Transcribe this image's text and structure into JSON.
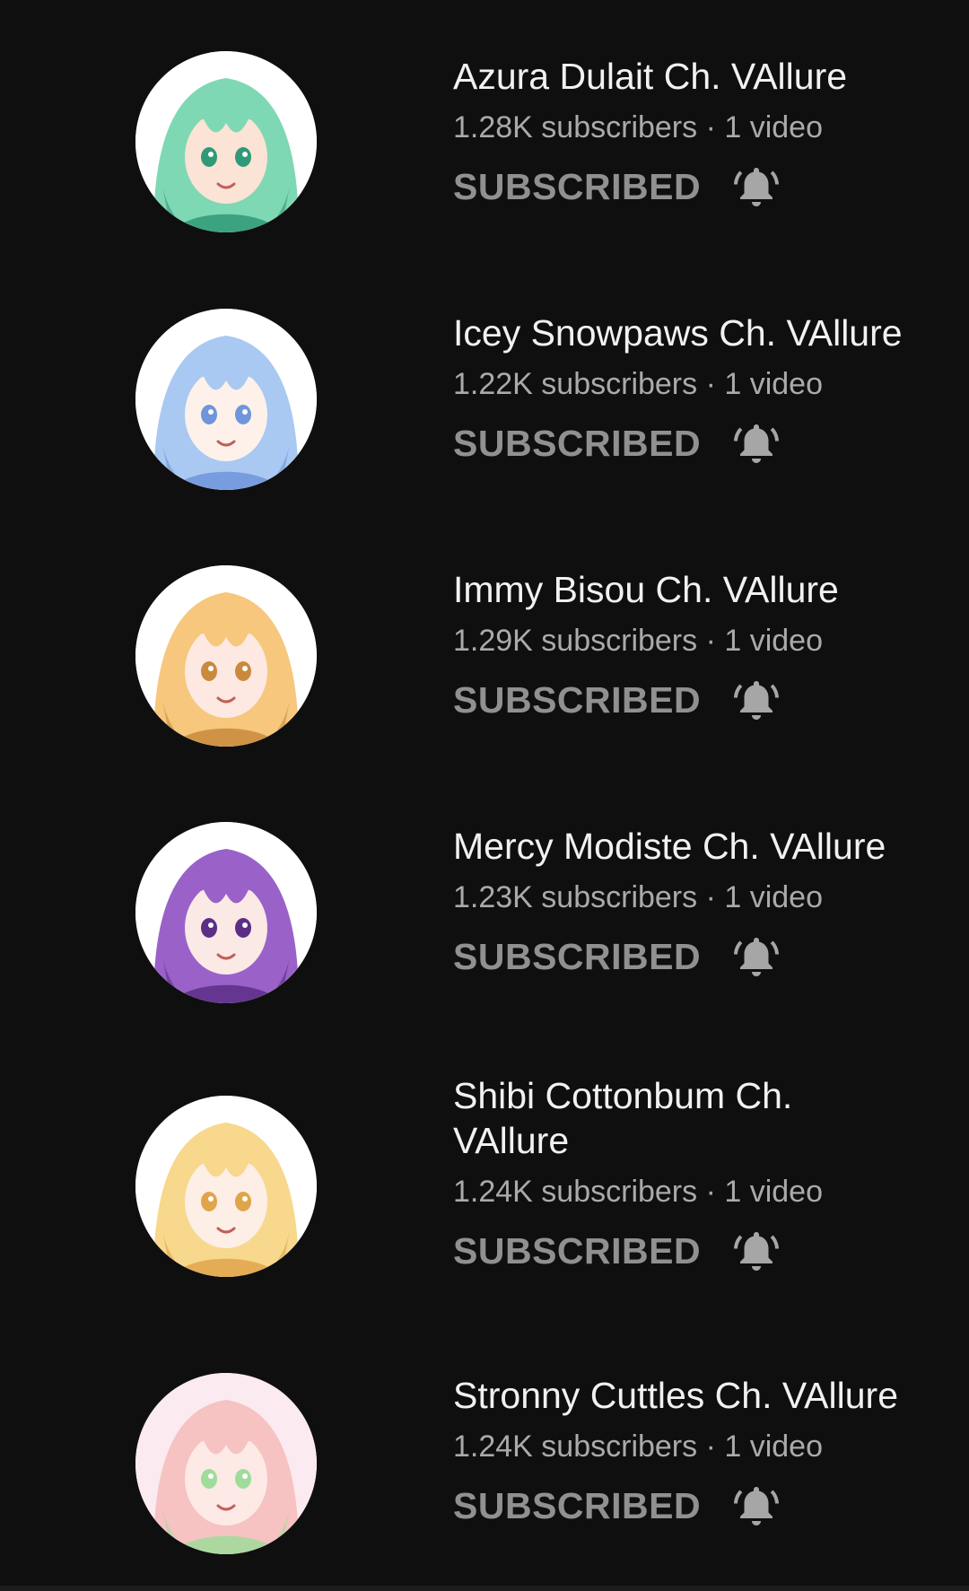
{
  "channels": [
    {
      "name": "Azura Dulait Ch. VAllure",
      "meta": "1.28K subscribers · 1 video",
      "button_label": "SUBSCRIBED",
      "bell_icon": "bell-ringing-icon",
      "avatar_colors": {
        "hair": "#7fd8b4",
        "accent": "#2f9a77",
        "skin": "#fbe3d6",
        "bg": "#ffffff"
      }
    },
    {
      "name": "Icey Snowpaws Ch. VAllure",
      "meta": "1.22K subscribers · 1 video",
      "button_label": "SUBSCRIBED",
      "bell_icon": "bell-ringing-icon",
      "avatar_colors": {
        "hair": "#a9c9f2",
        "accent": "#6f95db",
        "skin": "#fdf1ea",
        "bg": "#ffffff"
      }
    },
    {
      "name": "Immy Bisou Ch. VAllure",
      "meta": "1.29K subscribers · 1 video",
      "button_label": "SUBSCRIBED",
      "bell_icon": "bell-ringing-icon",
      "avatar_colors": {
        "hair": "#f6c77c",
        "accent": "#c98a3d",
        "skin": "#fde9e2",
        "bg": "#ffffff"
      }
    },
    {
      "name": "Mercy Modiste Ch. VAllure",
      "meta": "1.23K subscribers · 1 video",
      "button_label": "SUBSCRIBED",
      "bell_icon": "bell-ringing-icon",
      "avatar_colors": {
        "hair": "#9a62c9",
        "accent": "#5b2f86",
        "skin": "#fbe9e6",
        "bg": "#ffffff"
      }
    },
    {
      "name": "Shibi Cottonbum Ch. VAllure",
      "meta": "1.24K subscribers · 1 video",
      "button_label": "SUBSCRIBED",
      "bell_icon": "bell-ringing-icon",
      "avatar_colors": {
        "hair": "#f7d88c",
        "accent": "#e0a54a",
        "skin": "#fdeee6",
        "bg": "#ffffff"
      }
    },
    {
      "name": "Stronny Cuttles Ch. VAllure",
      "meta": "1.24K subscribers · 1 video",
      "button_label": "SUBSCRIBED",
      "bell_icon": "bell-ringing-icon",
      "avatar_colors": {
        "hair": "#f6c2c2",
        "accent": "#9fdc9a",
        "skin": "#fde9e6",
        "bg": "#fbeaf0"
      }
    }
  ]
}
